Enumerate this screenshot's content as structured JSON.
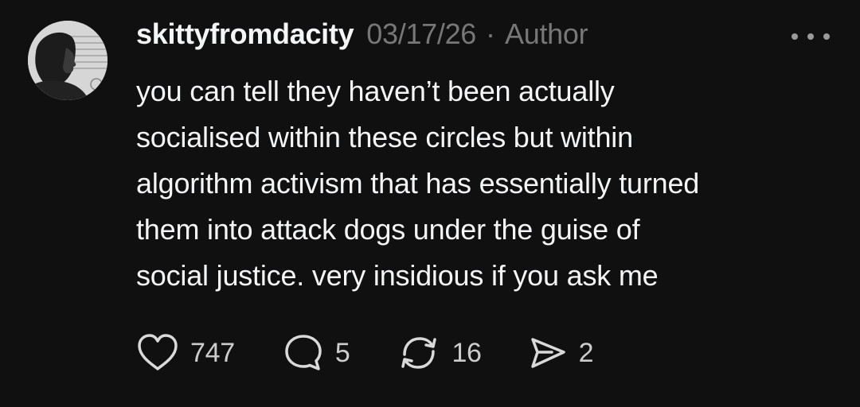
{
  "post": {
    "username": "skittyfromdacity",
    "date": "03/17/26",
    "separator": "·",
    "author_tag": "Author",
    "avatar_icon": "user-avatar-photo",
    "more_icon": "more-horizontal-icon",
    "lines": [
      "you can tell they haven’t been actually",
      "socialised within these circles but within",
      "algorithm activism that has essentially turned",
      "them into attack dogs under the guise of",
      "social justice. very insidious if you ask me"
    ]
  },
  "actions": {
    "like": {
      "icon": "heart-icon",
      "count": "747"
    },
    "reply": {
      "icon": "comment-icon",
      "count": "5"
    },
    "repost": {
      "icon": "repost-icon",
      "count": "16"
    },
    "share": {
      "icon": "send-icon",
      "count": "2"
    }
  },
  "colors": {
    "background": "#101010",
    "primary_text": "#f3f5f7",
    "secondary_text": "#777777"
  }
}
